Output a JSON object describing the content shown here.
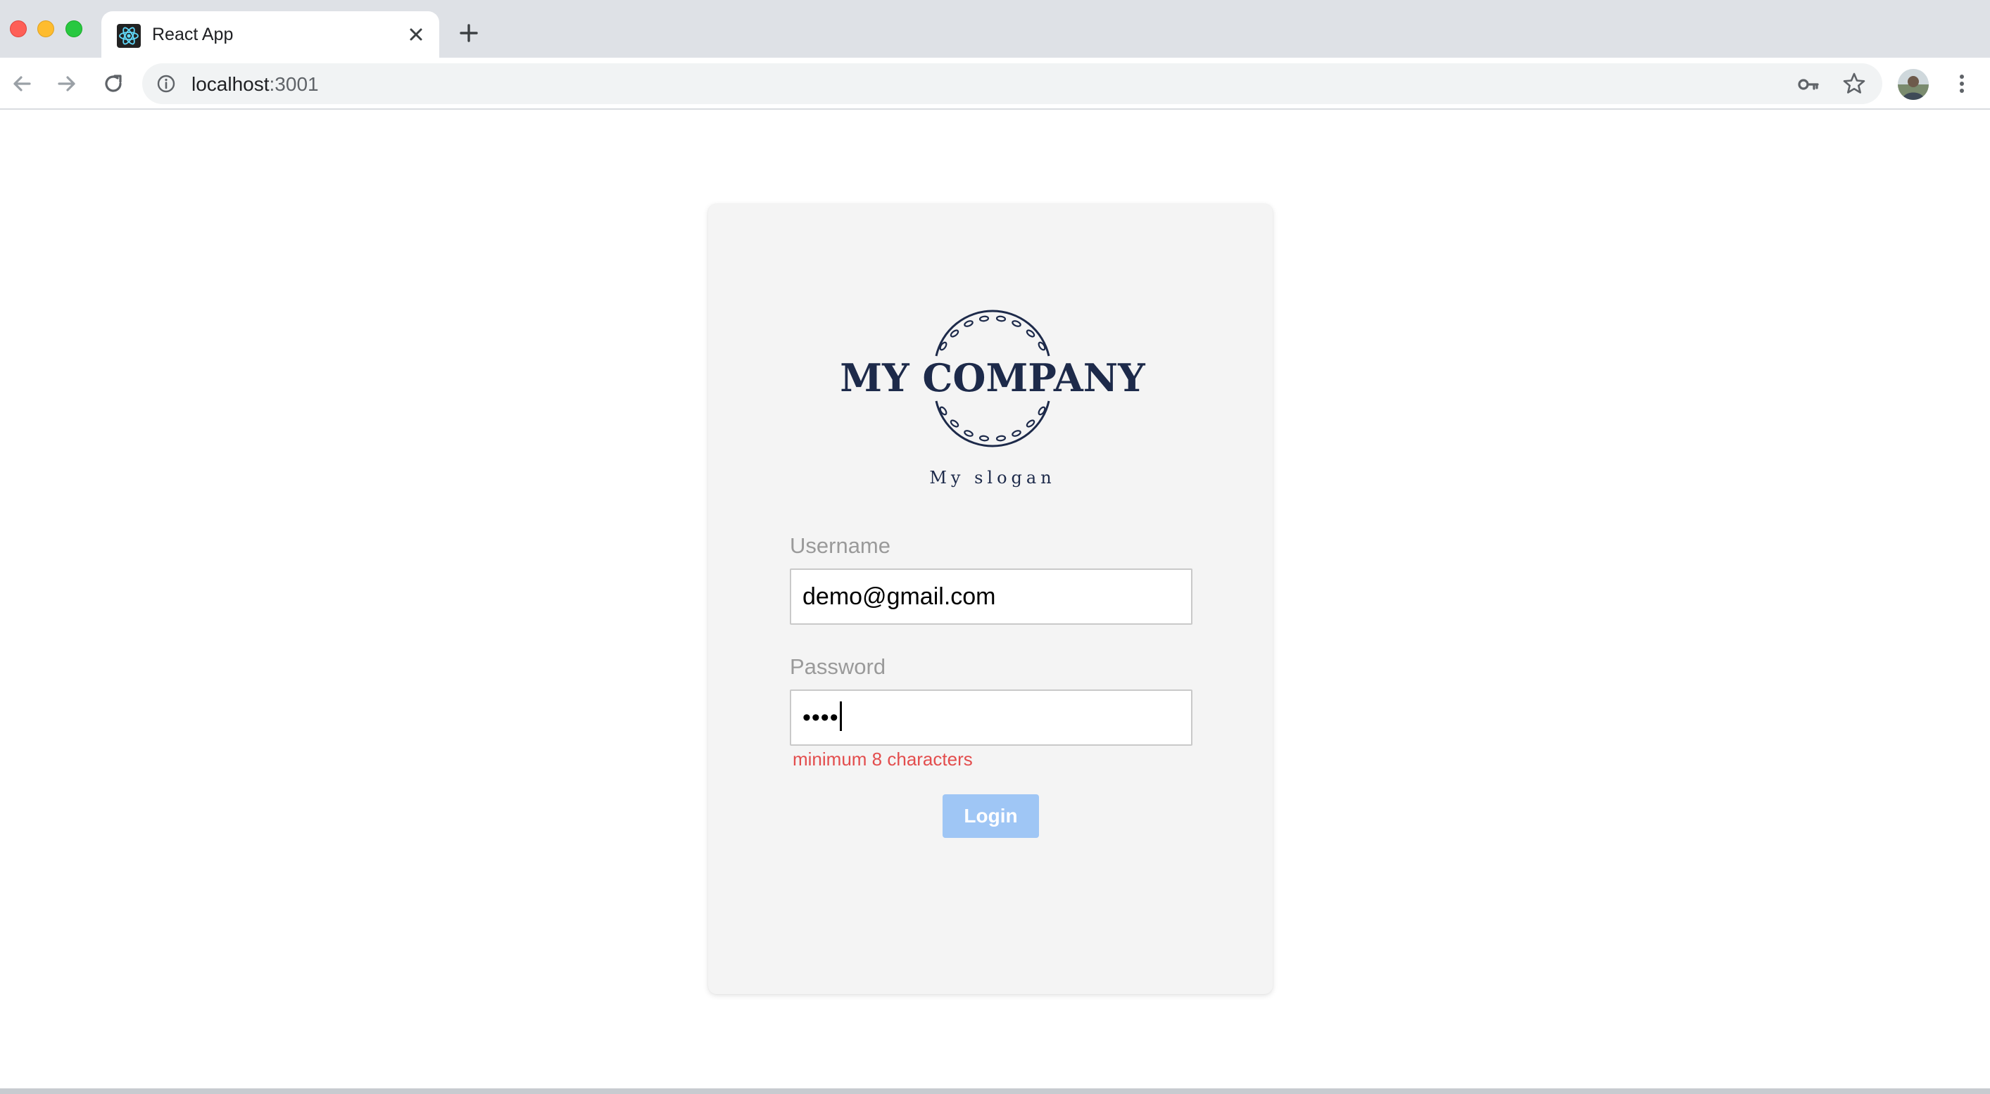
{
  "browser": {
    "tab": {
      "title": "React App",
      "favicon": "react-logo-icon"
    },
    "new_tab_icon": "plus-icon",
    "address_bar": {
      "host": "localhost",
      "port": ":3001"
    },
    "icons": [
      "back-arrow-icon",
      "forward-arrow-icon",
      "reload-icon",
      "info-icon",
      "key-icon",
      "star-icon",
      "avatar",
      "more-vert-icon"
    ]
  },
  "login": {
    "logo": {
      "text": "MY COMPANY",
      "slogan": "My slogan",
      "color": "#1d2a4a"
    },
    "username": {
      "label": "Username",
      "value": "demo@gmail.com"
    },
    "password": {
      "label": "Password",
      "masked_value": "••••",
      "error": "minimum 8 characters"
    },
    "submit": {
      "label": "Login",
      "color": "#9fc6f5"
    }
  }
}
